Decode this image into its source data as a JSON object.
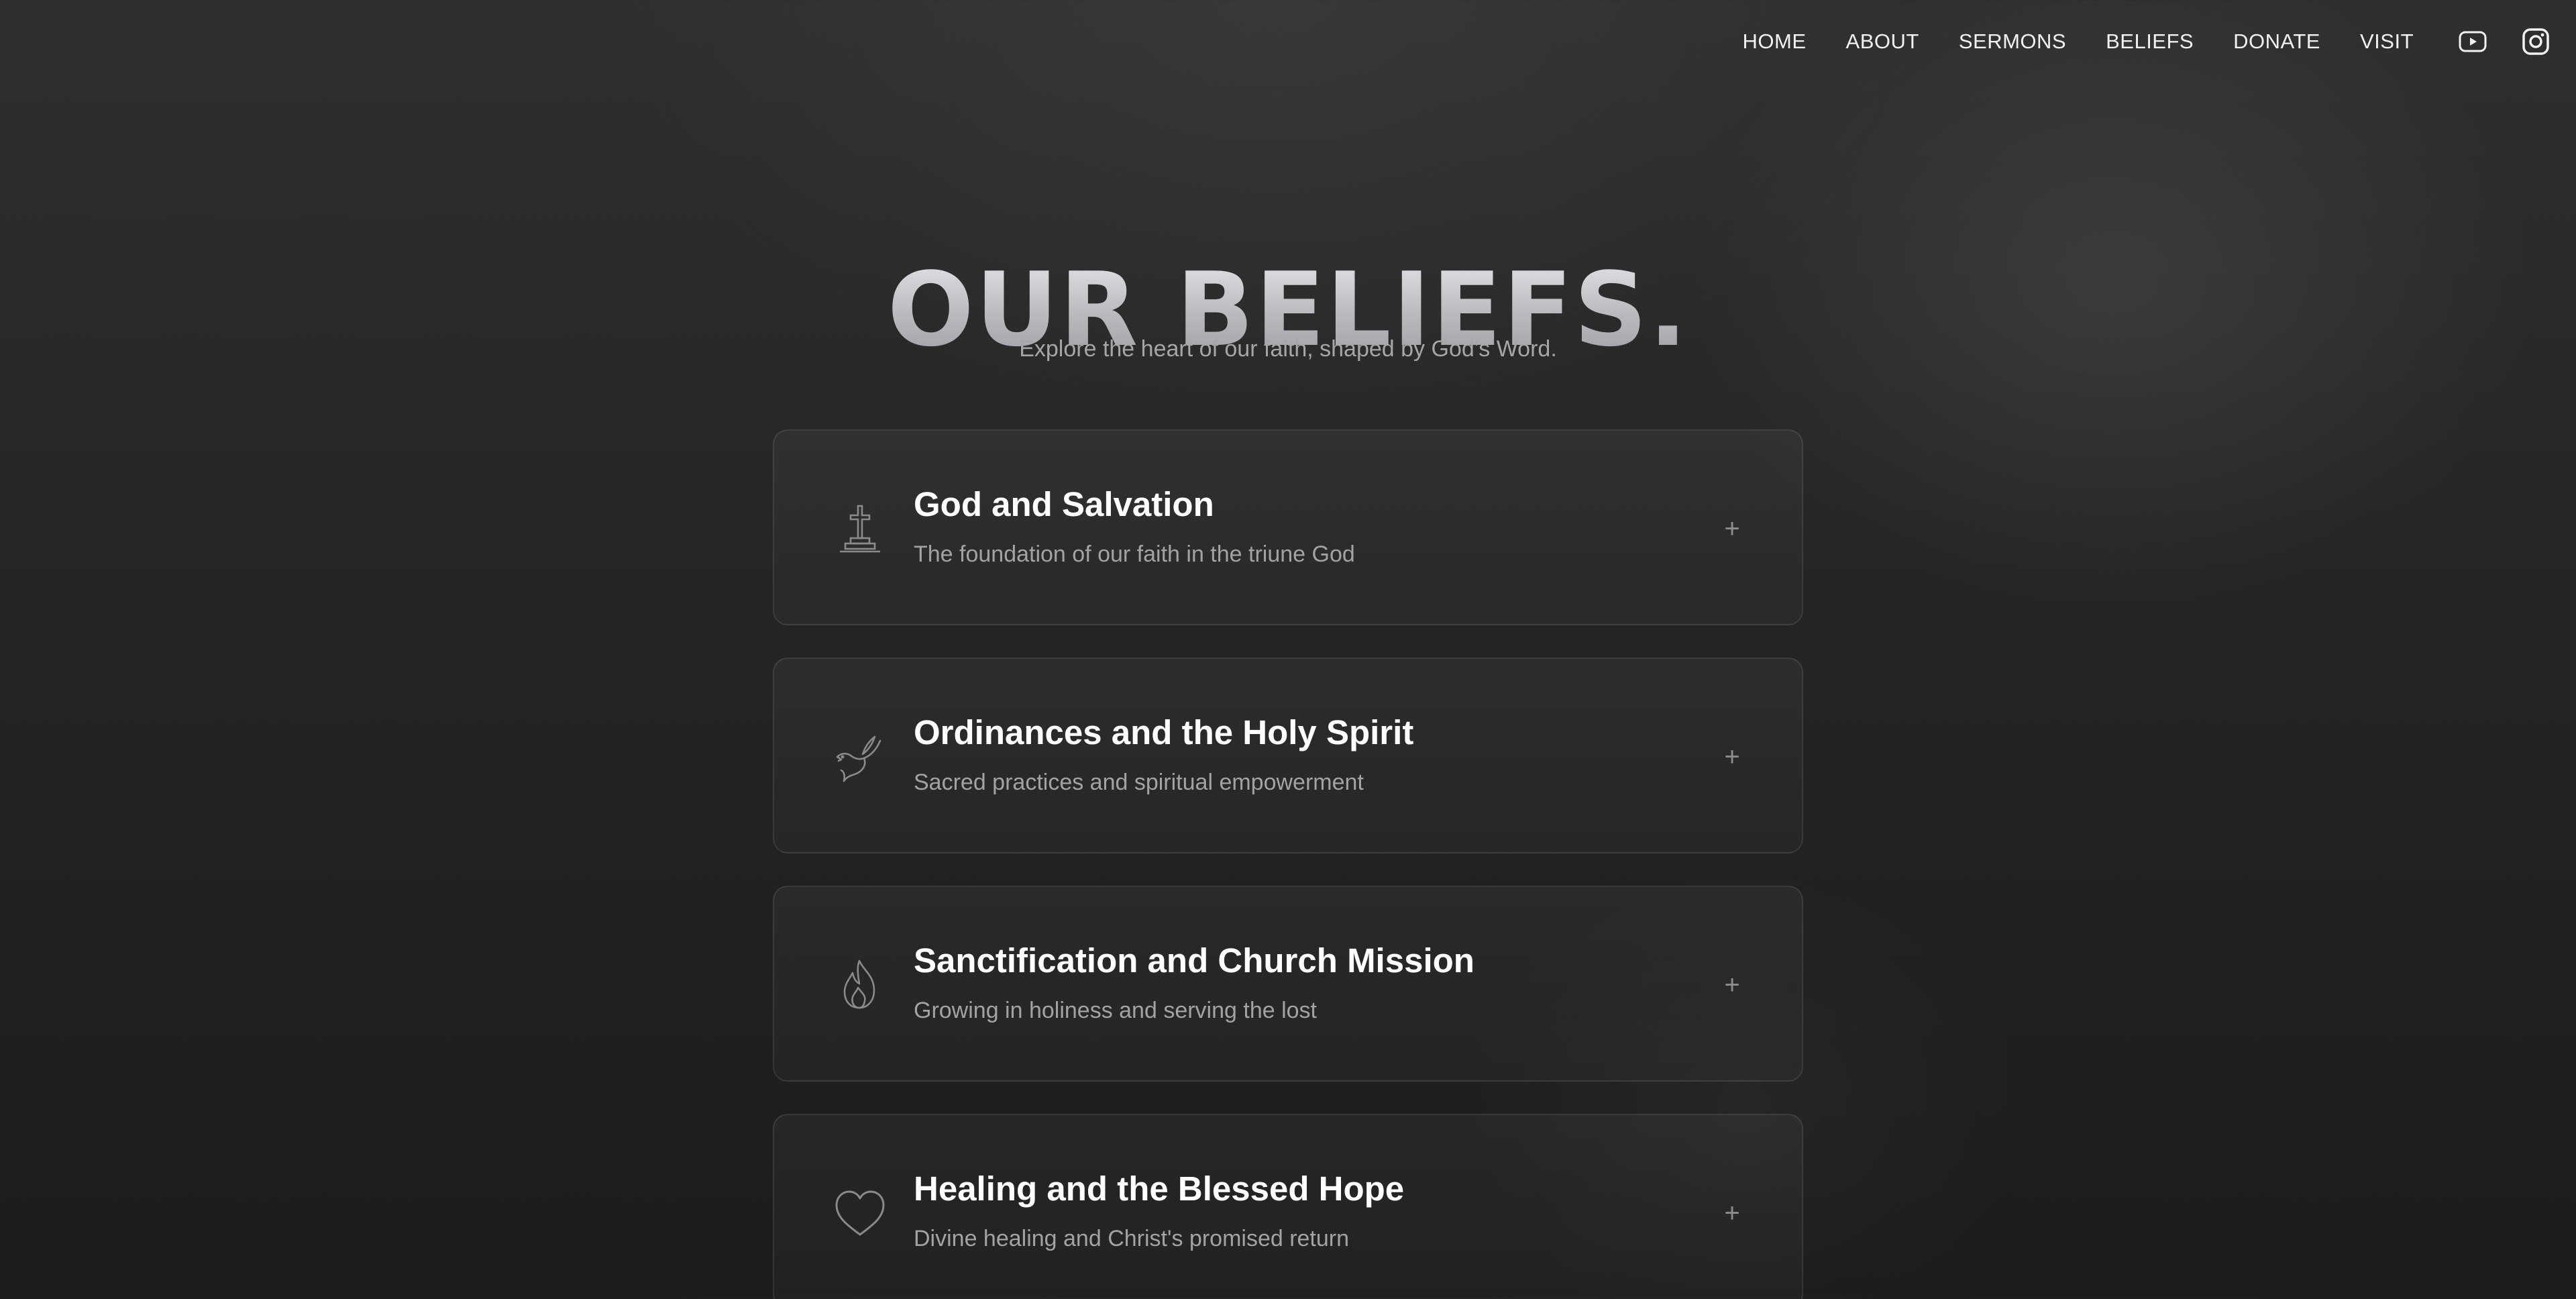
{
  "nav": {
    "items": [
      {
        "label": "HOME"
      },
      {
        "label": "ABOUT"
      },
      {
        "label": "SERMONS"
      },
      {
        "label": "BELIEFS"
      },
      {
        "label": "DONATE"
      },
      {
        "label": "VISIT"
      }
    ],
    "social": [
      {
        "icon": "youtube-icon"
      },
      {
        "icon": "instagram-icon"
      }
    ]
  },
  "hero": {
    "title": "OUR BELIEFS.",
    "subtitle": "Explore the heart of our faith, shaped by God's Word."
  },
  "beliefs": [
    {
      "icon": "cross-icon",
      "title": "God and Salvation",
      "description": "The foundation of our faith in the triune God",
      "toggle": "+"
    },
    {
      "icon": "dove-icon",
      "title": "Ordinances and the Holy Spirit",
      "description": "Sacred practices and spiritual empowerment",
      "toggle": "+"
    },
    {
      "icon": "flame-icon",
      "title": "Sanctification and Church Mission",
      "description": "Growing in holiness and serving the lost",
      "toggle": "+"
    },
    {
      "icon": "heart-icon",
      "title": "Healing and the Blessed Hope",
      "description": "Divine healing and Christ's promised return",
      "toggle": "+"
    }
  ],
  "colors": {
    "background": "#262626",
    "card_border": "#3a3a3a",
    "text_primary": "#ffffff",
    "text_muted": "#a3a3a5",
    "icon": "#8a8a8c"
  }
}
